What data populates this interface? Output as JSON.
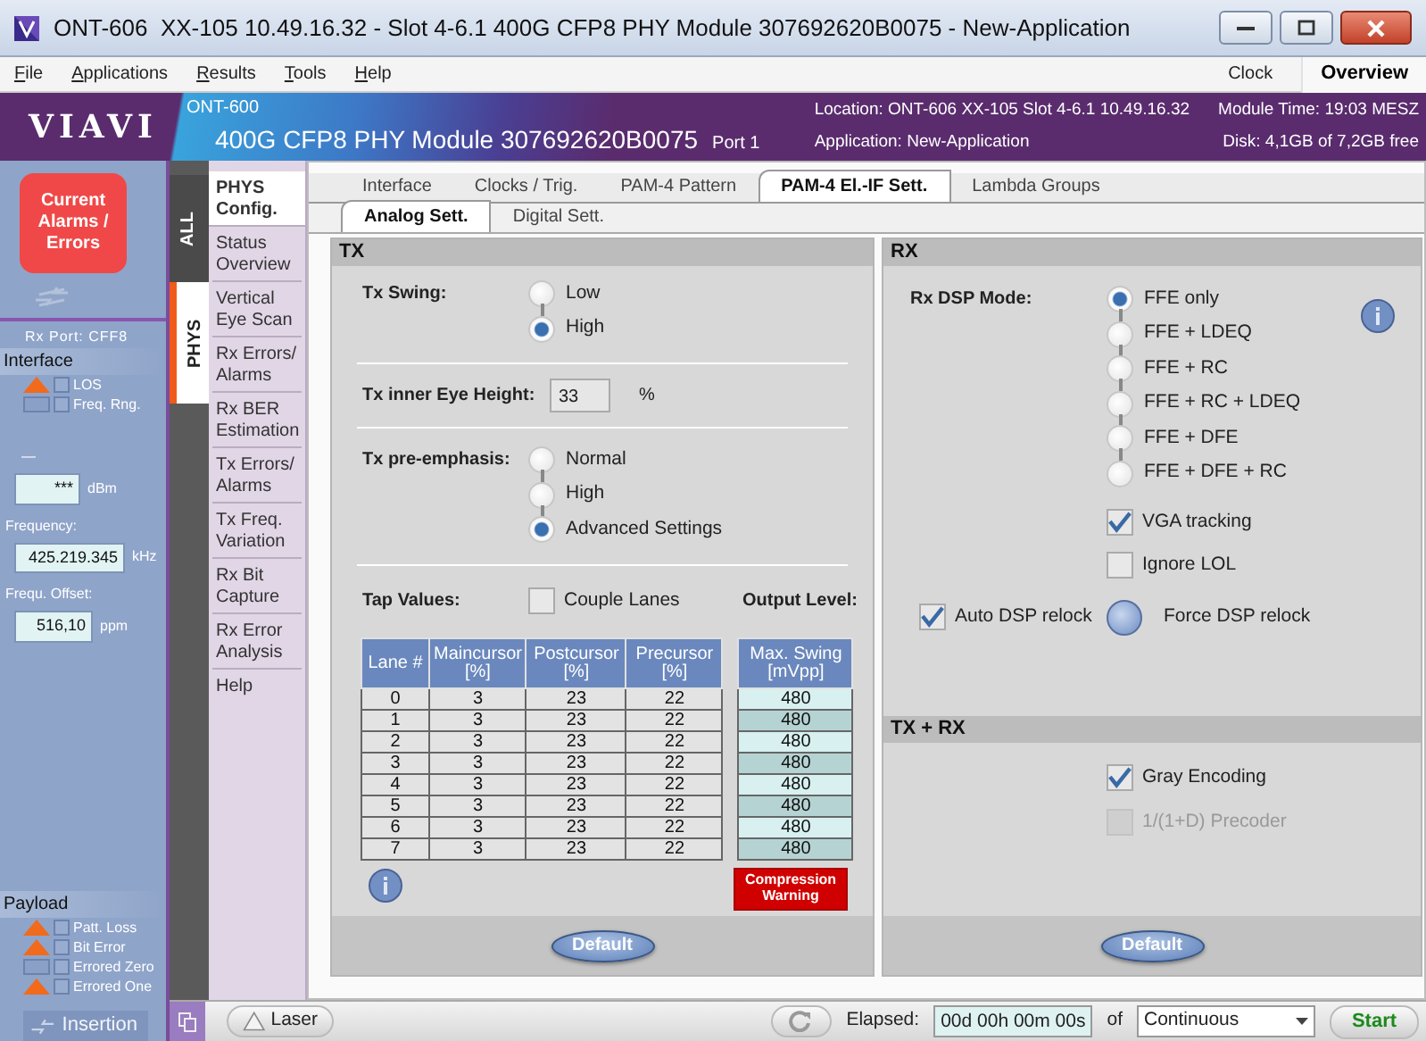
{
  "window": {
    "title": "ONT-606  XX-105 10.49.16.32 - Slot 4-6.1 400G CFP8 PHY Module 307692620B0075 - New-Application"
  },
  "menu": [
    "File",
    "Applications",
    "Results",
    "Tools",
    "Help"
  ],
  "toolbar": {
    "clock": "Clock",
    "overview": "Overview"
  },
  "header": {
    "logo": "VIAVI",
    "product": "ONT-600",
    "module": "400G CFP8 PHY Module 307692620B0075",
    "port": "Port 1",
    "location": "Location: ONT-606 XX-105 Slot 4-6.1  10.49.16.32",
    "application": "Application: New-Application",
    "module_time": "Module Time: 19:03 MESZ",
    "disk": "Disk: 4,1GB of 7,2GB free"
  },
  "alarm_panel": {
    "alarm_button": "Current Alarms / Errors",
    "rx_port": "Rx Port: CFF8",
    "interface": {
      "title": "Interface",
      "alarms": [
        {
          "label": "LOS",
          "active": true,
          "checked": false
        },
        {
          "label": "Freq. Rng.",
          "active": false,
          "checked": false
        }
      ]
    },
    "power": {
      "label": "—",
      "value": "***",
      "unit": "dBm"
    },
    "readings": [
      {
        "label": "Frequency:",
        "value": "425.219.345",
        "unit": "kHz"
      },
      {
        "label": "Frequ. Offset:",
        "value": "516,10",
        "unit": "ppm"
      }
    ],
    "payload": {
      "title": "Payload",
      "alarms": [
        {
          "label": "Patt. Loss",
          "active": true,
          "checked": false
        },
        {
          "label": "Bit Error",
          "active": true,
          "checked": false
        },
        {
          "label": "Errored Zero",
          "active": false,
          "checked": false
        },
        {
          "label": "Errored One",
          "active": true,
          "checked": false
        }
      ]
    },
    "insertion": "Insertion"
  },
  "side_tabs": [
    {
      "label": "ALL",
      "selected": false
    },
    {
      "label": "PHYS",
      "selected": true
    }
  ],
  "nav": [
    {
      "label": "PHYS Config.",
      "selected": true
    },
    {
      "label": "Status Overview",
      "selected": false
    },
    {
      "label": "Vertical Eye Scan",
      "selected": false
    },
    {
      "label": "Rx Errors/ Alarms",
      "selected": false
    },
    {
      "label": "Rx BER Estimation",
      "selected": false
    },
    {
      "label": "Tx Errors/ Alarms",
      "selected": false
    },
    {
      "label": "Tx Freq. Variation",
      "selected": false
    },
    {
      "label": "Rx Bit Capture",
      "selected": false
    },
    {
      "label": "Rx Error Analysis",
      "selected": false
    },
    {
      "label": "Help",
      "selected": false
    }
  ],
  "tabs": [
    {
      "label": "Interface",
      "selected": false
    },
    {
      "label": "Clocks / Trig.",
      "selected": false
    },
    {
      "label": "PAM-4 Pattern",
      "selected": false
    },
    {
      "label": "PAM-4 El.-IF Sett.",
      "selected": true
    },
    {
      "label": "Lambda Groups",
      "selected": false
    }
  ],
  "subtabs": [
    {
      "label": "Analog Sett.",
      "selected": true
    },
    {
      "label": "Digital Sett.",
      "selected": false
    }
  ],
  "tx": {
    "title": "TX",
    "swing": {
      "label": "Tx Swing:",
      "options": [
        {
          "label": "Low",
          "selected": false
        },
        {
          "label": "High",
          "selected": true
        }
      ]
    },
    "eye_height": {
      "label": "Tx inner Eye Height:",
      "value": "33",
      "unit": "%"
    },
    "pre_emphasis": {
      "label": "Tx pre-emphasis:",
      "options": [
        {
          "label": "Normal",
          "selected": false
        },
        {
          "label": "High",
          "selected": false
        },
        {
          "label": "Advanced Settings",
          "selected": true
        }
      ]
    },
    "tap_values": {
      "label": "Tap Values:",
      "couple_lanes": {
        "label": "Couple Lanes",
        "checked": false
      },
      "output_label": "Output Level:"
    },
    "table": {
      "columns": [
        {
          "label": "Lane #"
        },
        {
          "label": "Maincursor",
          "unit": "[%]"
        },
        {
          "label": "Postcursor",
          "unit": "[%]"
        },
        {
          "label": "Precursor",
          "unit": "[%]"
        }
      ],
      "rows": [
        [
          "0",
          "3",
          "23",
          "22"
        ],
        [
          "1",
          "3",
          "23",
          "22"
        ],
        [
          "2",
          "3",
          "23",
          "22"
        ],
        [
          "3",
          "3",
          "23",
          "22"
        ],
        [
          "4",
          "3",
          "23",
          "22"
        ],
        [
          "5",
          "3",
          "23",
          "22"
        ],
        [
          "6",
          "3",
          "23",
          "22"
        ],
        [
          "7",
          "3",
          "23",
          "22"
        ]
      ]
    },
    "output": {
      "column": {
        "label": "Max. Swing",
        "unit": "[mVpp]"
      },
      "values": [
        "480",
        "480",
        "480",
        "480",
        "480",
        "480",
        "480",
        "480"
      ]
    },
    "warning": "Compression Warning",
    "default_button": "Default"
  },
  "rx": {
    "title": "RX",
    "dsp_mode": {
      "label": "Rx DSP Mode:",
      "options": [
        {
          "label": "FFE only",
          "selected": true
        },
        {
          "label": "FFE + LDEQ",
          "selected": false
        },
        {
          "label": "FFE + RC",
          "selected": false
        },
        {
          "label": "FFE + RC + LDEQ",
          "selected": false
        },
        {
          "label": "FFE + DFE",
          "selected": false
        },
        {
          "label": "FFE + DFE + RC",
          "selected": false
        }
      ]
    },
    "checks": [
      {
        "label": "VGA tracking",
        "checked": true
      },
      {
        "label": "Ignore LOL",
        "checked": false
      }
    ],
    "auto_relock": {
      "label": "Auto DSP relock",
      "checked": true
    },
    "force_relock": "Force DSP relock"
  },
  "txrx": {
    "title": "TX + RX",
    "checks": [
      {
        "label": "Gray Encoding",
        "checked": true,
        "disabled": false
      },
      {
        "label": "1/(1+D) Precoder",
        "checked": false,
        "disabled": true
      }
    ],
    "default_button": "Default"
  },
  "status_bar": {
    "laser": "Laser",
    "elapsed_label": "Elapsed:",
    "elapsed": "00d 00h 00m 00s",
    "of": "of",
    "mode": "Continuous",
    "start": "Start"
  }
}
